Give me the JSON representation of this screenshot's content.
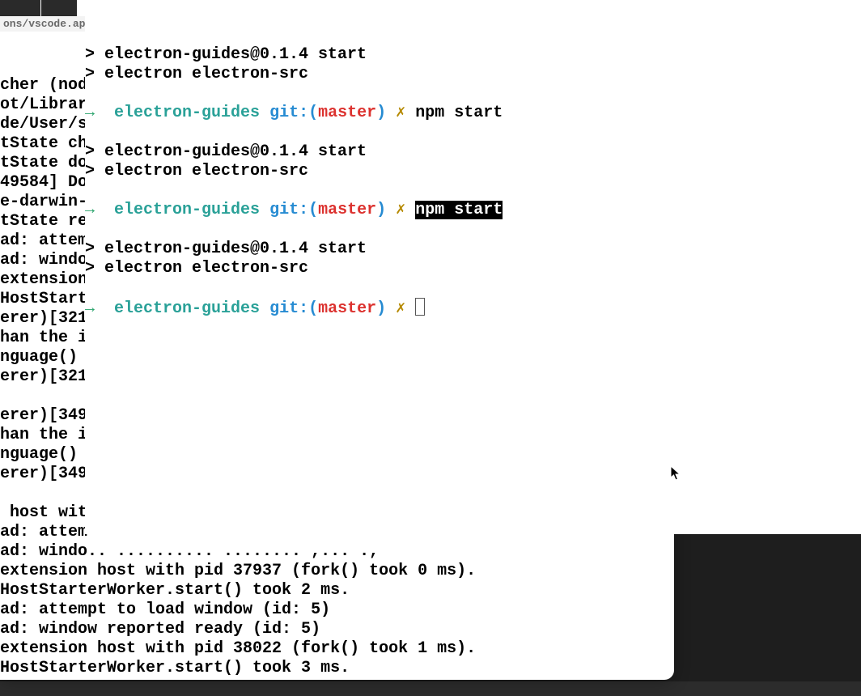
{
  "background": {
    "breadcrumb": "ons/vscode.app",
    "log_lines": [
      "",
      "cher (node",
      "ot/Librar",
      "de/User/s",
      "tState ch",
      "tState do",
      "49584] Do",
      "e-darwin-",
      "tState re",
      "ad: attem",
      "ad: windo",
      "extension",
      "HostStart",
      "erer)[321",
      "han the i",
      "nguage()",
      "erer)[321",
      "",
      "erer)[349",
      "han the i",
      "nguage()",
      "erer)[349",
      "",
      " host wit",
      "ad: attem",
      "ad: windo.. .......... ........ ,... .,",
      "extension host with pid 37937 (fork() took 0 ms).",
      "HostStarterWorker.start() took 2 ms.",
      "ad: attempt to load window (id: 5)",
      "ad: window reported ready (id: 5)",
      "extension host with pid 38022 (fork() took 1 ms).",
      "HostStarterWorker.start() took 3 ms."
    ]
  },
  "terminal": {
    "prompt": {
      "arrow": "→",
      "dir": "electron-guides",
      "git_prefix": "git:(",
      "branch": "master",
      "git_suffix": ")",
      "dirty": "✗"
    },
    "command": "npm start",
    "output": [
      "> electron-guides@0.1.4 start",
      "> electron electron-src"
    ],
    "blocks": [
      {
        "has_prompt_above": true,
        "command_visible_partial": true
      },
      {
        "has_prompt_above": false
      },
      {
        "has_prompt_above": false
      },
      {
        "has_prompt_above": false
      }
    ]
  }
}
